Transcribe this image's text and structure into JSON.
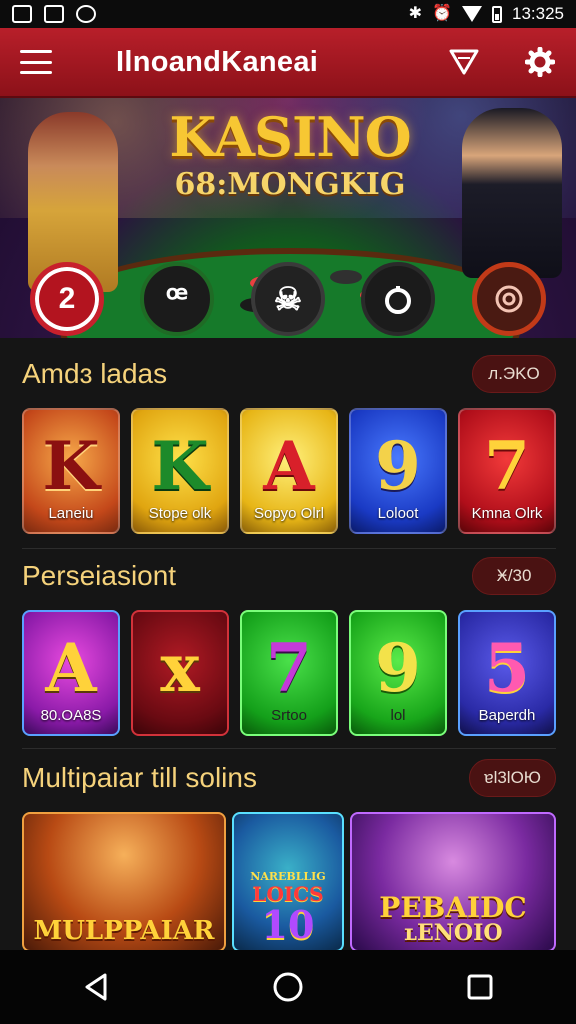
{
  "status_bar": {
    "time": "13:325",
    "icons": [
      "image-icon",
      "gallery-icon",
      "app-notification-icon",
      "bluetooth-icon",
      "alarm-icon",
      "signal-icon",
      "battery-icon"
    ]
  },
  "app_bar": {
    "title": "IlnoandKaneai",
    "icons": [
      "menu-icon",
      "filter-icon",
      "settings-icon"
    ]
  },
  "hero": {
    "logo_line1": "KASINO",
    "logo_line2": "68:MONGKIG"
  },
  "categories": [
    {
      "label": "2",
      "icon": "number-icon",
      "ring": "#c8202c"
    },
    {
      "label": "",
      "icon": "five-icon",
      "ring": "#1f6b25"
    },
    {
      "label": "",
      "icon": "skull-icon",
      "ring": "#3a3a3a"
    },
    {
      "label": "",
      "icon": "power-icon",
      "ring": "#2a2a2a"
    },
    {
      "label": "",
      "icon": "target-icon",
      "ring": "#c23a18"
    }
  ],
  "sections": [
    {
      "title": "Amdɜ ladas",
      "pill": "ᴫ.ЭKO",
      "tiles": [
        {
          "glyph": "K",
          "label": "Laneiu"
        },
        {
          "glyph": "K",
          "label": "Stope olk"
        },
        {
          "glyph": "A",
          "label": "Sopyo Olrl"
        },
        {
          "glyph": "9",
          "label": "Loloot"
        },
        {
          "glyph": "7",
          "label": "Kmna Olrk"
        }
      ]
    },
    {
      "title": "Perseiasiont",
      "pill": "Ӿ/30",
      "tiles": [
        {
          "glyph": "A",
          "label": "80.OA8S"
        },
        {
          "glyph": "x",
          "label": ""
        },
        {
          "glyph": "7",
          "label": "Srtoo"
        },
        {
          "glyph": "9",
          "label": "lol"
        },
        {
          "glyph": "5",
          "label": "Baperdh"
        }
      ]
    },
    {
      "title": "Multipaiar till solins",
      "pill": "ɐl3lOЮ",
      "promos": [
        {
          "text": "MULPPAIAR"
        },
        {
          "text_top": "NAREBLLIG",
          "text_mid": "LOICS",
          "text_big": "10"
        },
        {
          "text": "PEBAIDC",
          "text2": "ʟENOIO"
        }
      ]
    }
  ],
  "nav_bar": {
    "icons": [
      "back-icon",
      "home-icon",
      "recents-icon"
    ]
  }
}
